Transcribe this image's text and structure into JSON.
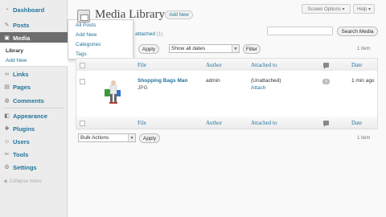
{
  "sidebar": {
    "items": [
      {
        "label": "Dashboard",
        "icon": "dashboard-icon",
        "glyph": "◔"
      },
      {
        "label": "Posts",
        "icon": "pin-icon",
        "glyph": "✎"
      },
      {
        "label": "Media",
        "icon": "media-icon",
        "glyph": "▣"
      },
      {
        "label": "Links",
        "icon": "links-icon",
        "glyph": "∞"
      },
      {
        "label": "Pages",
        "icon": "pages-icon",
        "glyph": "▤"
      },
      {
        "label": "Comments",
        "icon": "comments-icon",
        "glyph": "◍"
      },
      {
        "label": "Appearance",
        "icon": "appearance-icon",
        "glyph": "◧"
      },
      {
        "label": "Plugins",
        "icon": "plugins-icon",
        "glyph": "✚"
      },
      {
        "label": "Users",
        "icon": "users-icon",
        "glyph": "☺"
      },
      {
        "label": "Tools",
        "icon": "tools-icon",
        "glyph": "✂"
      },
      {
        "label": "Settings",
        "icon": "settings-icon",
        "glyph": "⚙"
      }
    ],
    "media_sub": {
      "library": "Library",
      "add_new": "Add New"
    },
    "collapse": "Collapse menu"
  },
  "posts_flyout": [
    "All Posts",
    "Add New",
    "Categories",
    "Tags"
  ],
  "header": {
    "screen_options": "Screen Options ▾",
    "help": "Help ▾",
    "title": "Media Library",
    "add_new": "Add New"
  },
  "filters": {
    "attached": "attached",
    "attached_count": "(1)",
    "search_button": "Search Media",
    "apply": "Apply",
    "dates_select": "Show all dates",
    "filter_button": "Filter",
    "items_count": "1 item"
  },
  "table": {
    "columns": [
      "File",
      "Author",
      "Attached to",
      "Date"
    ],
    "rows": [
      {
        "file": "Shopping Bags Man",
        "type": "JPG",
        "author": "admin",
        "attached": "(Unattached)",
        "attach_link": "Attach",
        "comments": "0",
        "date": "1 min ago"
      }
    ]
  },
  "bulk": {
    "select": "Bulk Actions",
    "apply": "Apply",
    "items_count": "1 item"
  },
  "colors": {
    "link": "#21759b",
    "active_menu": "#6d6d6d",
    "sidebar": "#ececec"
  }
}
